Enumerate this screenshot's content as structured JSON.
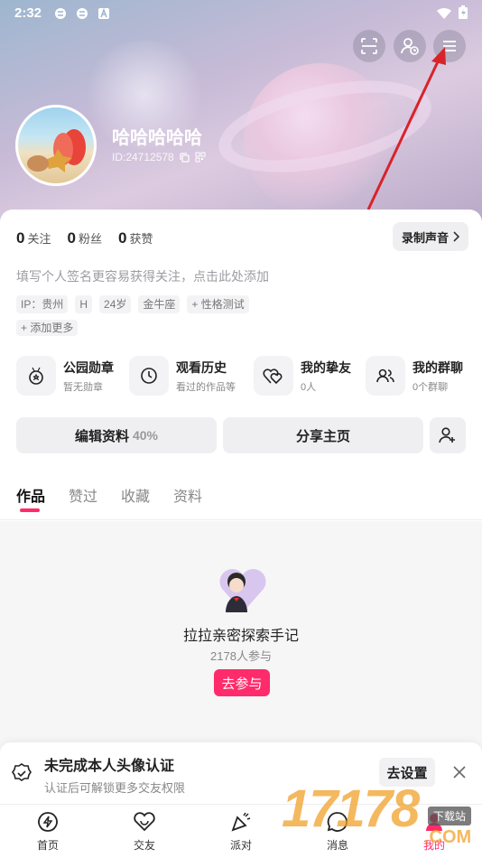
{
  "status_bar": {
    "time": "2:32"
  },
  "header": {
    "username": "哈哈哈哈哈",
    "user_id": "ID:24712578"
  },
  "stats": [
    {
      "num": "0",
      "label": "关注"
    },
    {
      "num": "0",
      "label": "粉丝"
    },
    {
      "num": "0",
      "label": "获赞"
    }
  ],
  "record_button": "录制声音",
  "signature_placeholder": "填写个人签名更容易获得关注，点击此处添加",
  "tags": [
    "IP：贵州",
    "H",
    "24岁",
    "金牛座",
    "性格测试"
  ],
  "add_more": "添加更多",
  "features": [
    {
      "title": "公园勋章",
      "sub": "暂无勋章",
      "icon": "medal-icon"
    },
    {
      "title": "观看历史",
      "sub": "看过的作品等",
      "icon": "clock-icon"
    },
    {
      "title": "我的挚友",
      "sub": "0人",
      "icon": "hearts-icon"
    },
    {
      "title": "我的群聊",
      "sub": "0个群聊",
      "icon": "group-icon"
    }
  ],
  "edit_profile": {
    "label": "编辑资料",
    "percent": "40%"
  },
  "share_home": "分享主页",
  "tabs": [
    "作品",
    "赞过",
    "收藏",
    "资料"
  ],
  "empty_state": {
    "title": "拉拉亲密探索手记",
    "count": "2178人参与",
    "button": "去参与"
  },
  "banner": {
    "title": "未完成本人头像认证",
    "subtitle": "认证后可解锁更多交友权限",
    "button": "去设置"
  },
  "nav": [
    "首页",
    "交友",
    "派对",
    "消息",
    "我的"
  ],
  "watermark": {
    "digits": "17178",
    "tag": "下载站",
    "com": ".COM"
  },
  "colors": {
    "accent": "#ff2b6a",
    "arrow": "#d8232a"
  }
}
